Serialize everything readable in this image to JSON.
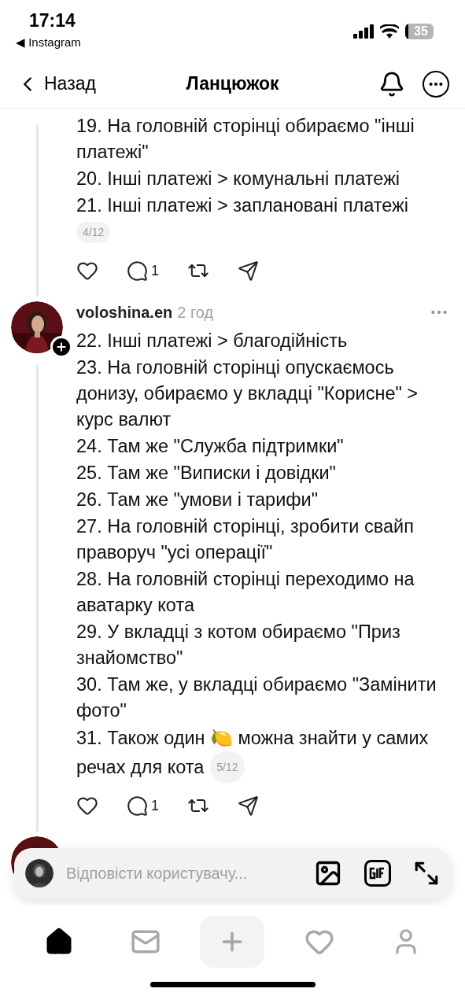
{
  "status_bar": {
    "time": "17:14",
    "back_app": "◀ Instagram",
    "battery": "35"
  },
  "header": {
    "back": "Назад",
    "title": "Ланцюжок"
  },
  "posts": [
    {
      "lines": [
        "19. На головній сторінці обираємо \"інші платежі\"",
        "20. Інші платежі > комунальні платежі",
        "21. Інші платежі > заплановані платежі"
      ],
      "counter": "4/12",
      "comments": "1"
    },
    {
      "user": "voloshina.en",
      "time": "2 год",
      "follow": true,
      "lines": [
        "22. Інші платежі > благодійність",
        "23. На головній сторінці опускаємось донизу, обираємо у вкладці \"Корисне\" > курс валют",
        "24. Там же \"Служба підтримки\"",
        "25. Там же \"Виписки і довідки\"",
        "26. Там же \"умови і тарифи\"",
        "27. На головній сторінці, зробити свайп праворуч \"усі операції\"",
        "28. На головній сторінці переходимо на аватарку кота",
        "29. У вкладці з котом обираємо \"Приз знайомство\"",
        "30. Там же, у вкладці обираємо \"Замінити фото\""
      ],
      "last": [
        "31. Також один 🍋 можна знайти у самих",
        "речах для кота"
      ],
      "counter": "5/12",
      "comments": "1"
    },
    {
      "avatar": {
        "kind": "picture"
      }
    }
  ],
  "reply_bar": {
    "placeholder": "Відповісти користувачу..."
  },
  "nav": [
    {
      "kind": "home",
      "selected": true
    },
    {
      "kind": "messages",
      "selected": false
    },
    {
      "kind": "create",
      "selected": false
    },
    {
      "kind": "activity",
      "selected": false
    },
    {
      "kind": "profile",
      "selected": false
    }
  ]
}
